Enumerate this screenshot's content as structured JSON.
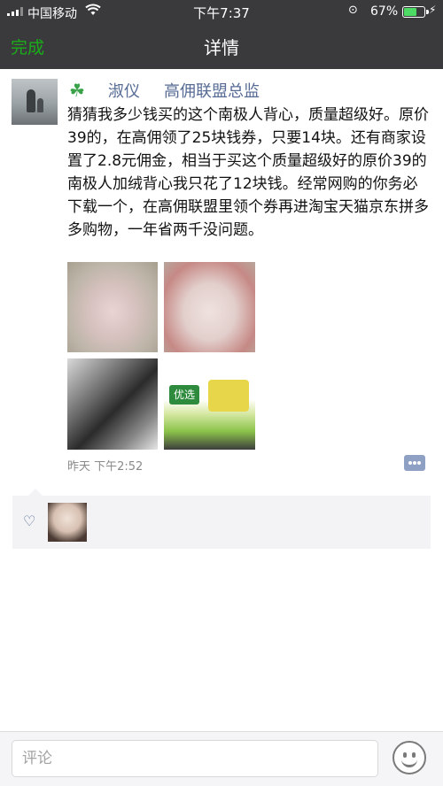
{
  "status_bar": {
    "carrier": "中国移动",
    "time": "下午7:37",
    "battery_percent": "67%",
    "battery_level": 0.67,
    "icons": [
      "signal-icon",
      "wifi-icon",
      "orientation-lock-icon",
      "battery-icon",
      "charging-icon"
    ]
  },
  "nav": {
    "done_label": "完成",
    "title": "详情"
  },
  "post": {
    "user_name": "淑仪",
    "user_title": "高佣联盟总监",
    "content": "猜猜我多少钱买的这个南极人背心，质量超级好。原价39的，在高佣领了25块钱券，只要14块。还有商家设置了2.8元佣金，相当于买这个质量超级好的原价39的南极人加绒背心我只花了12块钱。经常网购的你务必下载一个，在高佣联盟里领个券再进淘宝天猫京东拼多多购物，一年省两千没问题。",
    "photos": [
      {
        "name": "photo-pink-vest"
      },
      {
        "name": "photo-vest-fabric"
      },
      {
        "name": "photo-dark-fabric"
      },
      {
        "name": "photo-tissue-package",
        "label": "优选"
      }
    ],
    "timestamp": "昨天 下午2:52"
  },
  "likes": {
    "count": 1
  },
  "comment_bar": {
    "placeholder": "评论"
  },
  "colors": {
    "accent_green": "#1aad19",
    "link_blue": "#576b95",
    "nav_background": "#3a3a3c"
  }
}
